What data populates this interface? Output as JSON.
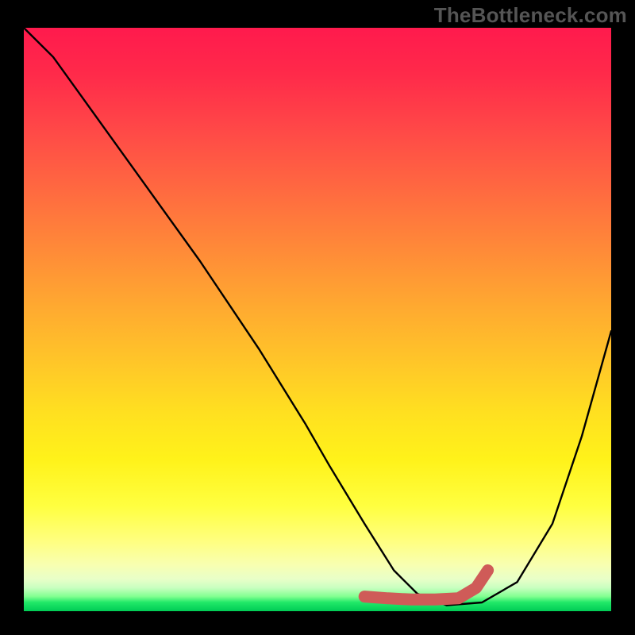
{
  "watermark": "TheBottleneck.com",
  "chart_data": {
    "type": "line",
    "title": "",
    "xlabel": "",
    "ylabel": "",
    "xlim": [
      0,
      100
    ],
    "ylim": [
      0,
      100
    ],
    "series": [
      {
        "name": "main-curve",
        "color": "#000000",
        "x": [
          0,
          5,
          10,
          20,
          30,
          40,
          48,
          52,
          58,
          63,
          67,
          72,
          78,
          84,
          90,
          95,
          100
        ],
        "values": [
          100,
          95,
          88,
          74,
          60,
          45,
          32,
          25,
          15,
          7,
          3,
          1,
          1.5,
          5,
          15,
          30,
          48
        ]
      },
      {
        "name": "highlight-region",
        "color": "#d05a58",
        "x": [
          58,
          62,
          66,
          70,
          74,
          77,
          79
        ],
        "values": [
          2.5,
          2.2,
          2.0,
          2.0,
          2.2,
          4,
          7
        ]
      }
    ],
    "annotations": []
  }
}
